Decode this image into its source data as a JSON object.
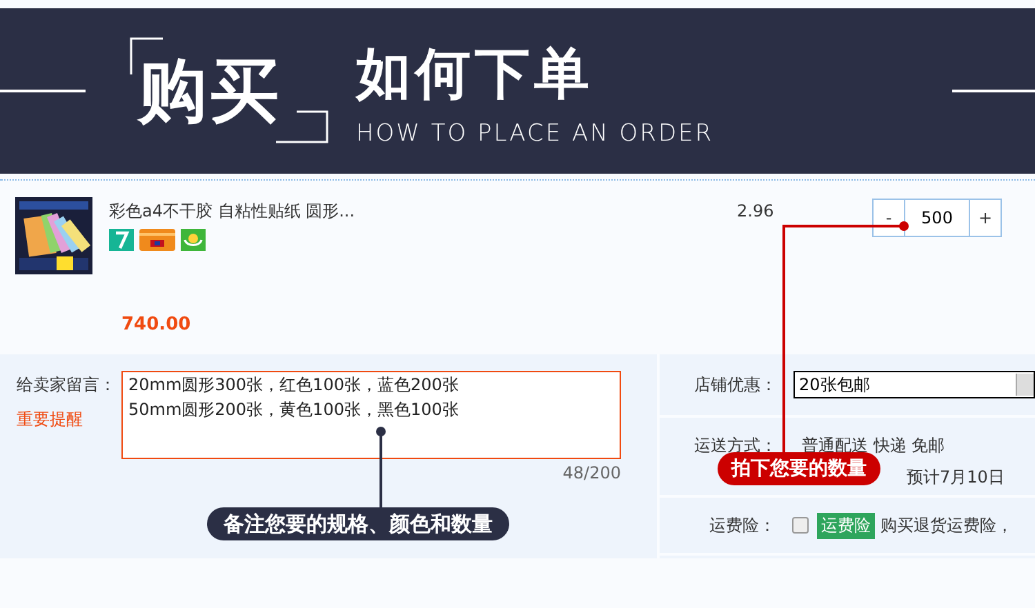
{
  "banner": {
    "title_box": "购买",
    "title": "如何下单",
    "subtitle": "HOW TO PLACE AN ORDER"
  },
  "item": {
    "name": "彩色a4不干胶 自粘性贴纸 圆形...",
    "price": "2.96",
    "quantity": {
      "minus": "-",
      "value": "500",
      "plus": "+"
    },
    "total": "740.00"
  },
  "message": {
    "label": "给卖家留言：",
    "reminder": "重要提醒",
    "lines": [
      "20mm圆形300张，红色100张，蓝色200张",
      "50mm圆形200张，黄色100张，黑色100张"
    ],
    "count": "48/200"
  },
  "store_discount": {
    "label": "店铺优惠：",
    "value": "20张包邮"
  },
  "shipping": {
    "label": "运送方式：",
    "method": "普通配送 快递 免邮",
    "estimate": "预计7月10日"
  },
  "insurance": {
    "label": "运费险：",
    "checked": false,
    "badge": "运费险",
    "text": "购买退货运费险，"
  },
  "callouts": [
    {
      "text": "拍下您要的数量",
      "color": "#cc0000"
    },
    {
      "text": "备注您要的规格、颜色和数量",
      "color": "#2b2f45"
    }
  ]
}
